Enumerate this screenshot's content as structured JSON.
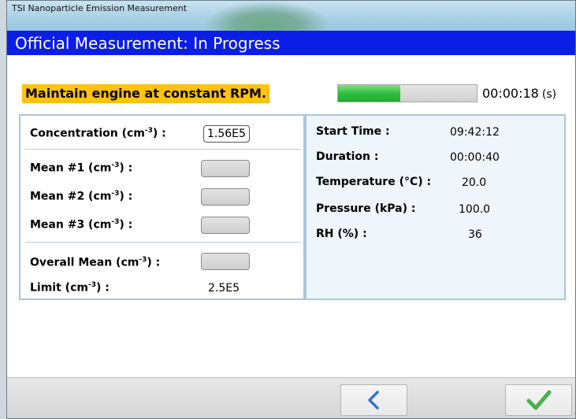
{
  "window": {
    "title": "TSI Nanoparticle Emission Measurement"
  },
  "header": {
    "title": "Official Measurement: In Progress"
  },
  "instruction": "Maintain engine at constant RPM.",
  "progress": {
    "fraction": 0.45,
    "elapsed": "00:00:18",
    "unit": "(s)"
  },
  "left": {
    "concentration_label": "Concentration (cm",
    "concentration_value": "1.56E5",
    "mean1_label": "Mean #1 (cm",
    "mean2_label": "Mean #2 (cm",
    "mean3_label": "Mean #3 (cm",
    "overall_label": "Overall Mean (cm",
    "limit_label": "Limit (cm",
    "limit_value": "2.5E5",
    "exp": "-3",
    "suffix": ") :"
  },
  "right": {
    "start_label": "Start Time :",
    "start_value": "09:42:12",
    "duration_label": "Duration :",
    "duration_value": "00:00:40",
    "temp_label": "Temperature (°C) :",
    "temp_value": "20.0",
    "pressure_label": "Pressure (kPa) :",
    "pressure_value": "100.0",
    "rh_label": "RH (%) :",
    "rh_value": "36"
  },
  "buttons": {
    "back_icon": "chevron-left-icon",
    "ok_icon": "checkmark-icon"
  },
  "colors": {
    "header": "#0a1ee8",
    "instruction_bg": "#ffc20e",
    "check": "#4caf50",
    "back": "#3a74c9"
  }
}
